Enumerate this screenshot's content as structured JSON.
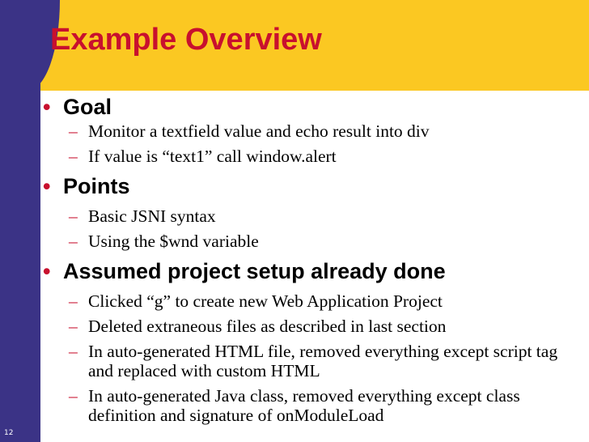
{
  "slide": {
    "title": "Example Overview",
    "page_number": "12",
    "bullet_glyph": "•",
    "dash_glyph": "–",
    "colors": {
      "left_bar": "#3b3386",
      "header_band": "#fbc822",
      "title": "#c8102e",
      "bullet": "#c8102e",
      "text": "#000000"
    }
  },
  "sections": [
    {
      "heading": "Goal",
      "items": [
        "Monitor a textfield value and echo result into div",
        "If value is “text1” call window.alert"
      ]
    },
    {
      "heading": "Points",
      "items": [
        "Basic JSNI syntax",
        "Using the $wnd variable"
      ]
    },
    {
      "heading": "Assumed project setup already done",
      "items": [
        "Clicked “g” to create new Web Application Project",
        "Deleted extraneous files as described in last section",
        "In auto-generated HTML file, removed everything except script tag and replaced with custom HTML",
        "In auto-generated Java class, removed everything except class definition and signature of onModuleLoad"
      ]
    }
  ]
}
